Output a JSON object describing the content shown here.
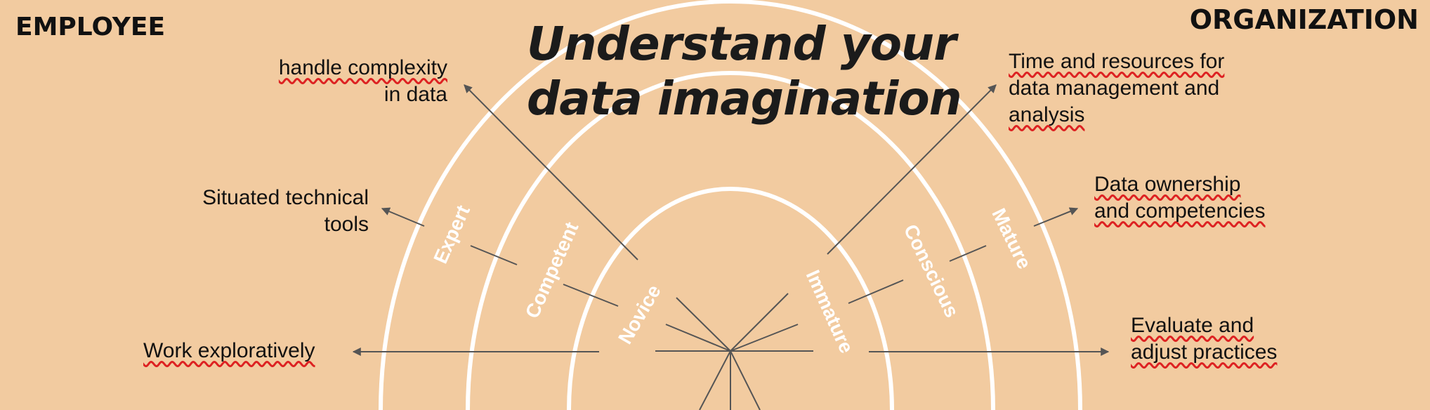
{
  "corners": {
    "left": "EMPLOYEE",
    "right": "ORGANIZATION"
  },
  "title": {
    "line1": "Understand your",
    "line2": "data imagination"
  },
  "employee_labels": {
    "complexity": [
      "handle complexity",
      "in data"
    ],
    "tools": [
      "Situated technical",
      "tools"
    ],
    "work": [
      "Work exploratively"
    ]
  },
  "organization_labels": {
    "resources": [
      "Time and resources for",
      "data management and",
      "analysis"
    ],
    "ownership": [
      "Data ownership",
      "and competencies"
    ],
    "evaluate": [
      "Evaluate and",
      "adjust practices"
    ]
  },
  "levels_employee": [
    "Novice",
    "Competent",
    "Expert"
  ],
  "levels_organization": [
    "Immature",
    "Conscious",
    "Mature"
  ],
  "colors": {
    "background": "#f2cba0",
    "arc": "#ffffff",
    "line": "#555555",
    "text": "#111111"
  }
}
